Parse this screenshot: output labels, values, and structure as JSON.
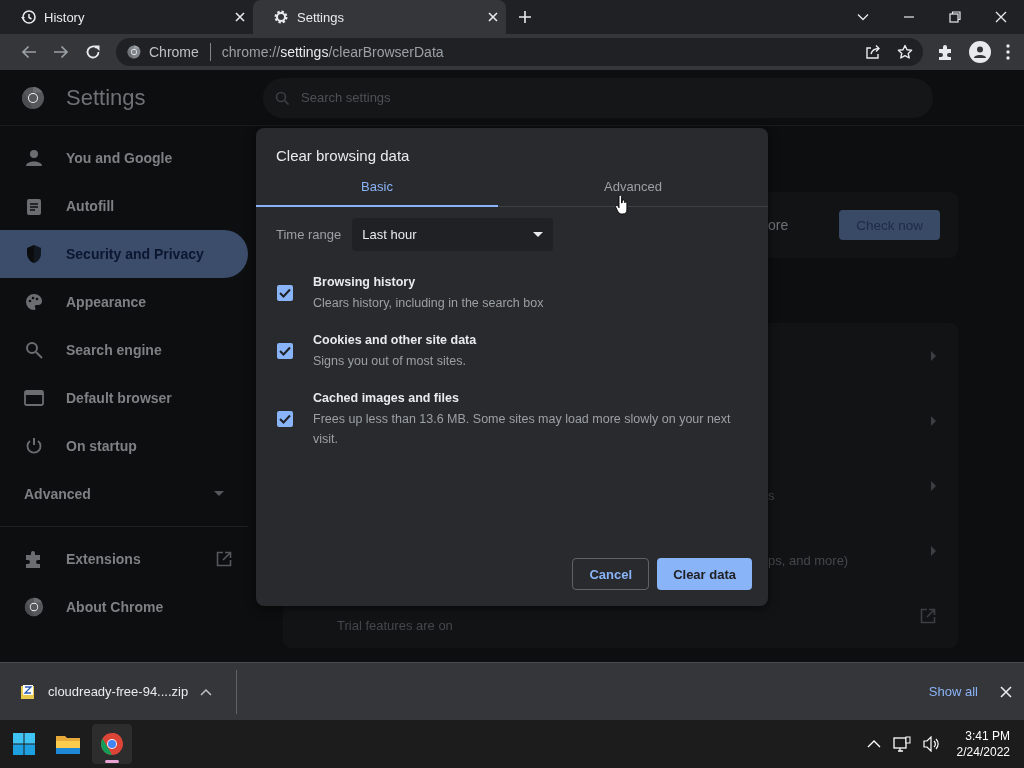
{
  "tabs": [
    {
      "title": "History",
      "selected": false
    },
    {
      "title": "Settings",
      "selected": true
    }
  ],
  "address_bar": {
    "origin_label": "Chrome",
    "url_scheme": "chrome://",
    "url_host": "settings",
    "url_path": "/clearBrowserData"
  },
  "settings_header": {
    "title": "Settings",
    "search_placeholder": "Search settings"
  },
  "sidebar": {
    "items": [
      {
        "label": "You and Google",
        "selected": false
      },
      {
        "label": "Autofill",
        "selected": false
      },
      {
        "label": "Security and Privacy",
        "selected": true
      },
      {
        "label": "Appearance",
        "selected": false
      },
      {
        "label": "Search engine",
        "selected": false
      },
      {
        "label": "Default browser",
        "selected": false
      },
      {
        "label": "On startup",
        "selected": false
      }
    ],
    "advanced": {
      "label": "Advanced",
      "expanded": false
    },
    "bottom_items": [
      {
        "label": "Extensions",
        "kind": "external"
      },
      {
        "label": "About Chrome",
        "kind": "plain"
      }
    ]
  },
  "safety_check": {
    "text": "ore",
    "button": "Check now"
  },
  "privacy_rows": [
    {
      "kind": "submenu"
    },
    {
      "kind": "submenu"
    },
    {
      "kind": "submenu",
      "secondary": "s"
    },
    {
      "kind": "submenu",
      "secondary": "ps, and more)"
    },
    {
      "kind": "external",
      "secondary": "Trial features are on"
    }
  ],
  "dialog": {
    "title": "Clear browsing data",
    "tabs": [
      {
        "label": "Basic",
        "selected": true
      },
      {
        "label": "Advanced",
        "selected": false
      }
    ],
    "time_range": {
      "label": "Time range",
      "value": "Last hour"
    },
    "options": [
      {
        "title": "Browsing history",
        "description": "Clears history, including in the search box",
        "checked": true
      },
      {
        "title": "Cookies and other site data",
        "description": "Signs you out of most sites.",
        "checked": true
      },
      {
        "title": "Cached images and files",
        "description": "Frees up less than 13.6 MB. Some sites may load more slowly on your next visit.",
        "checked": true
      }
    ],
    "buttons": {
      "cancel": "Cancel",
      "confirm": "Clear data"
    }
  },
  "download_bar": {
    "file": "cloudready-free-94....zip",
    "show_all": "Show all"
  },
  "taskbar": {
    "time": "3:41 PM",
    "date": "2/24/2022"
  }
}
